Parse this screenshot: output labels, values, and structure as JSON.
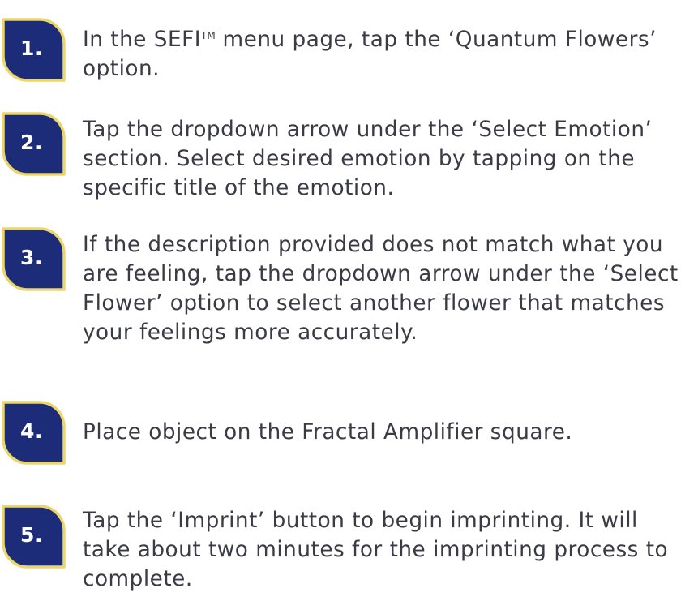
{
  "colors": {
    "badge_fill": "#1d2c78",
    "badge_border": "#ecd56a",
    "badge_text": "#ffffff",
    "body_text": "#3b3b45"
  },
  "steps": [
    {
      "number": "1.",
      "text_before": "In the SEFI",
      "trademark": "TM",
      "text_after": " menu page, tap the ‘Quantum Flowers’ option."
    },
    {
      "number": "2.",
      "text": "Tap the dropdown arrow under the ‘Select Emotion’ section. Select desired emotion by tapping on the specific title of the emotion."
    },
    {
      "number": "3.",
      "text": "If the description provided does not match what you are feeling, tap the dropdown arrow under the ‘Select Flower’ option to select another flower that matches your feelings more accurately."
    },
    {
      "number": "4.",
      "text": "Place object on the Fractal Amplifier square."
    },
    {
      "number": "5.",
      "text": "Tap the ‘Imprint’ button to begin imprinting. It will take about two minutes for the imprinting process to complete."
    }
  ]
}
